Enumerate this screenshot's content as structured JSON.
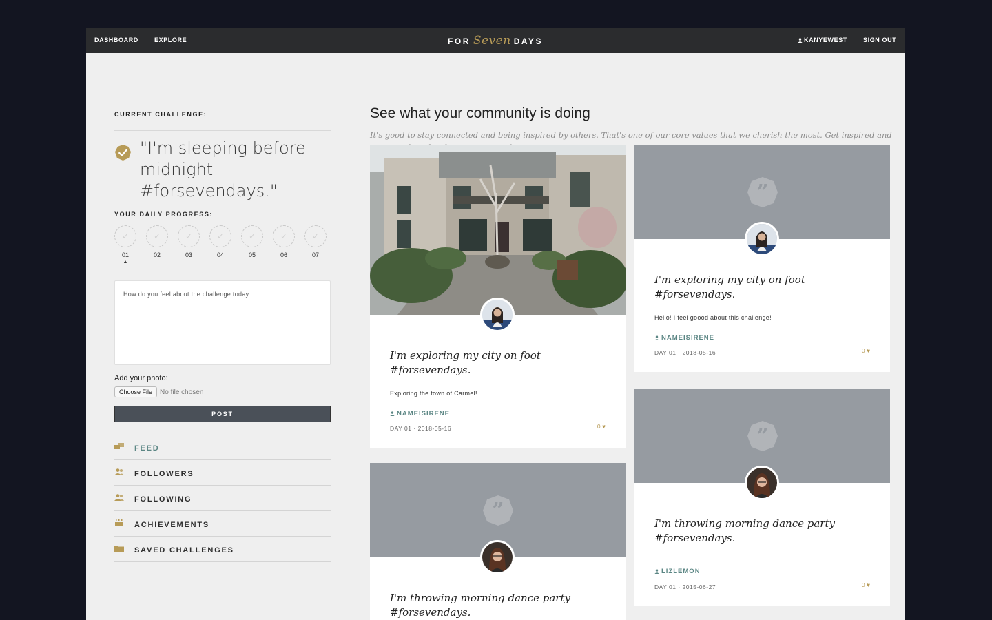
{
  "nav": {
    "dashboard": "DASHBOARD",
    "explore": "EXPLORE",
    "brand_left": "FOR",
    "brand_middle": "Seven",
    "brand_right": "DAYS",
    "user": "KANYEWEST",
    "signout": "SIGN OUT"
  },
  "sidebar": {
    "current_label": "CURRENT CHALLENGE:",
    "challenge_text": "\"I'm sleeping before midnight #forsevendays.\"",
    "progress_label": "YOUR DAILY PROGRESS:",
    "days": [
      "01",
      "02",
      "03",
      "04",
      "05",
      "06",
      "07"
    ],
    "current_day_marker": "▲",
    "textarea_placeholder": "How do you feel about the challenge today...",
    "add_photo": "Add your photo:",
    "choose_file": "Choose File",
    "no_file": "No file chosen",
    "post": "POST",
    "menu": [
      {
        "label": "FEED",
        "icon": "feed-icon"
      },
      {
        "label": "FOLLOWERS",
        "icon": "followers-icon"
      },
      {
        "label": "FOLLOWING",
        "icon": "following-icon"
      },
      {
        "label": "ACHIEVEMENTS",
        "icon": "achievements-icon"
      },
      {
        "label": "SAVED CHALLENGES",
        "icon": "folder-icon"
      }
    ]
  },
  "main": {
    "heading": "See what your community is doing",
    "intro": "It's good to stay connected and being inspired by others. That's one of our core values that we cherish the most. Get inspired and inspire others by sharing stories of yours too!",
    "cards": [
      {
        "title": "I'm exploring my city on foot #forsevendays.",
        "body": "Exploring the town of Carmel!",
        "author": "NAMEISIRENE",
        "meta": "DAY 01 · 2018-05-16",
        "likes": "0 ♥"
      },
      {
        "title": "I'm exploring my city on foot #forsevendays.",
        "body": "Hello! I feel goood about this challenge!",
        "author": "NAMEISIRENE",
        "meta": "DAY 01 · 2018-05-16",
        "likes": "0 ♥"
      },
      {
        "title": "I'm throwing morning dance party #forsevendays.",
        "body": "",
        "author": "LIZLEMON",
        "meta": "DAY 01 · 2015-06-27",
        "likes": "0 ♥"
      },
      {
        "title": "I'm throwing morning dance party #forsevendays.",
        "body": "",
        "author": "",
        "meta": "",
        "likes": ""
      }
    ]
  },
  "colors": {
    "nav_bg": "#2b2c2e",
    "accent_gold": "#b79b57",
    "accent_teal": "#5b8684",
    "placeholder_gray": "#969ba1"
  }
}
